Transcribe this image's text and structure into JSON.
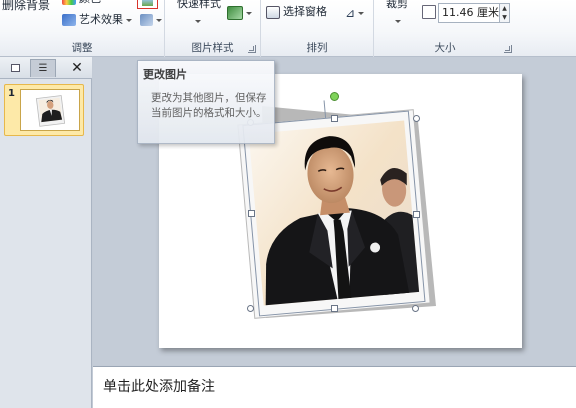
{
  "ribbon": {
    "remove_background": "删除背景",
    "color_partial": "颜色",
    "artistic_effects": "艺术效果",
    "quick_styles": "快速样式",
    "selection_pane": "选择窗格",
    "crop": "裁剪",
    "height_value": "11.46 厘米",
    "groups": {
      "adjust": "调整",
      "picture_styles": "图片样式",
      "arrange": "排列",
      "size": "大小"
    }
  },
  "slides_pane": {
    "slide_number": "1"
  },
  "tooltip": {
    "title": "更改图片",
    "body": "更改为其他图片，但保存当前图片的格式和大小。"
  },
  "notes": {
    "placeholder": "单击此处添加备注"
  },
  "colors": {
    "ribbon_bg": "#f5f7fa",
    "thumb_selected": "#fde9a8",
    "workspace": "#c4ccd7",
    "handle_rotate": "#7fd35a"
  }
}
